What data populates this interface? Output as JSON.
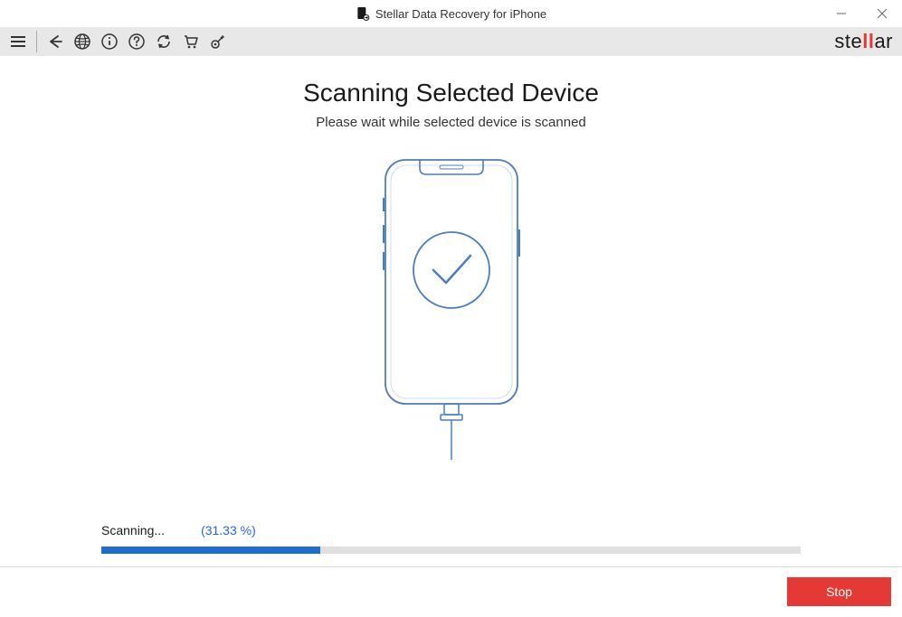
{
  "window": {
    "title": "Stellar Data Recovery for iPhone"
  },
  "brand": {
    "name": "stellar"
  },
  "main": {
    "heading": "Scanning Selected Device",
    "subheading": "Please wait while selected device is scanned"
  },
  "progress": {
    "status_label": "Scanning...",
    "percent_text": "(31.33 %)",
    "percent_value": 31.33
  },
  "actions": {
    "stop_label": "Stop"
  }
}
